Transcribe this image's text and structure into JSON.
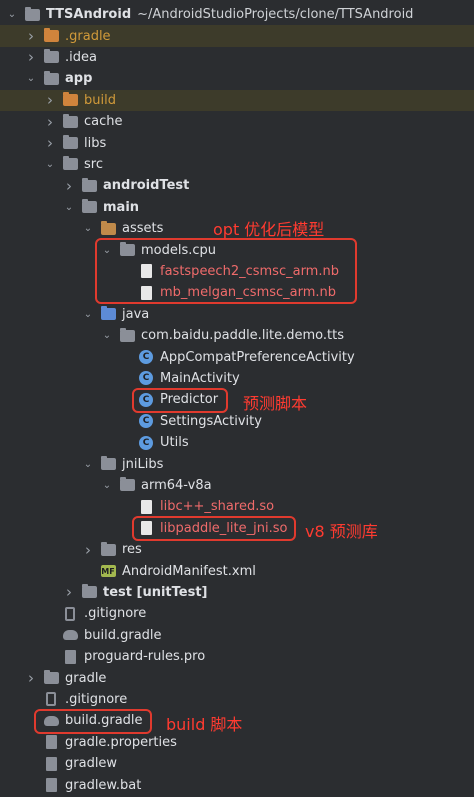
{
  "project": {
    "name": "TTSAndroid",
    "path": "~/AndroidStudioProjects/clone/TTSAndroid"
  },
  "tree": [
    {
      "label": "TTSAndroid",
      "hint": "~/AndroidStudioProjects/clone/TTSAndroid",
      "bold": true,
      "icon": "folder",
      "chev": "down",
      "depth": 0
    },
    {
      "label": ".gradle",
      "icon": "folder-orange",
      "chev": "right",
      "depth": 1,
      "style": "orange",
      "row": "hl-yellow"
    },
    {
      "label": ".idea",
      "icon": "folder",
      "chev": "right",
      "depth": 1
    },
    {
      "label": "app",
      "icon": "folder",
      "chev": "down",
      "depth": 1,
      "bold": true
    },
    {
      "label": "build",
      "icon": "folder-orange",
      "chev": "right",
      "depth": 2,
      "style": "orange",
      "row": "hl-yellow"
    },
    {
      "label": "cache",
      "icon": "folder",
      "chev": "right",
      "depth": 2
    },
    {
      "label": "libs",
      "icon": "folder",
      "chev": "right",
      "depth": 2
    },
    {
      "label": "src",
      "icon": "folder",
      "chev": "down",
      "depth": 2
    },
    {
      "label": "androidTest",
      "icon": "folder",
      "chev": "right",
      "depth": 3,
      "bold": true
    },
    {
      "label": "main",
      "icon": "folder",
      "chev": "down",
      "depth": 3,
      "bold": true
    },
    {
      "label": "assets",
      "icon": "folder-brown",
      "chev": "down",
      "depth": 4
    },
    {
      "label": "models.cpu",
      "icon": "folder",
      "chev": "down",
      "depth": 5
    },
    {
      "label": "fastspeech2_csmsc_arm.nb",
      "icon": "file",
      "chev": "none",
      "depth": 6,
      "style": "red"
    },
    {
      "label": "mb_melgan_csmsc_arm.nb",
      "icon": "file",
      "chev": "none",
      "depth": 6,
      "style": "red"
    },
    {
      "label": "java",
      "icon": "folder-blue",
      "chev": "down",
      "depth": 4
    },
    {
      "label": "com.baidu.paddle.lite.demo.tts",
      "icon": "folder",
      "chev": "down",
      "depth": 5
    },
    {
      "label": "AppCompatPreferenceActivity",
      "icon": "class",
      "chev": "none",
      "depth": 6
    },
    {
      "label": "MainActivity",
      "icon": "class",
      "chev": "none",
      "depth": 6
    },
    {
      "label": "Predictor",
      "icon": "class",
      "chev": "none",
      "depth": 6
    },
    {
      "label": "SettingsActivity",
      "icon": "class",
      "chev": "none",
      "depth": 6
    },
    {
      "label": "Utils",
      "icon": "class",
      "chev": "none",
      "depth": 6
    },
    {
      "label": "jniLibs",
      "icon": "folder",
      "chev": "down",
      "depth": 4
    },
    {
      "label": "arm64-v8a",
      "icon": "folder",
      "chev": "down",
      "depth": 5
    },
    {
      "label": "libc++_shared.so",
      "icon": "file",
      "chev": "none",
      "depth": 6,
      "style": "red"
    },
    {
      "label": "libpaddle_lite_jni.so",
      "icon": "file",
      "chev": "none",
      "depth": 6,
      "style": "red"
    },
    {
      "label": "res",
      "icon": "folder",
      "chev": "right",
      "depth": 4
    },
    {
      "label": "AndroidManifest.xml",
      "icon": "manifest",
      "chev": "none",
      "depth": 4
    },
    {
      "label": "test [unitTest]",
      "icon": "folder",
      "chev": "right",
      "depth": 3,
      "bold": true
    },
    {
      "label": ".gitignore",
      "icon": "git",
      "chev": "none",
      "depth": 2
    },
    {
      "label": "build.gradle",
      "icon": "gradle",
      "chev": "none",
      "depth": 2
    },
    {
      "label": "proguard-rules.pro",
      "icon": "file-gray",
      "chev": "none",
      "depth": 2
    },
    {
      "label": "gradle",
      "icon": "folder",
      "chev": "right",
      "depth": 1
    },
    {
      "label": ".gitignore",
      "icon": "git",
      "chev": "none",
      "depth": 1
    },
    {
      "label": "build.gradle",
      "icon": "gradle",
      "chev": "none",
      "depth": 1
    },
    {
      "label": "gradle.properties",
      "icon": "file-gray",
      "chev": "none",
      "depth": 1
    },
    {
      "label": "gradlew",
      "icon": "file-gray",
      "chev": "none",
      "depth": 1
    },
    {
      "label": "gradlew.bat",
      "icon": "file-gray",
      "chev": "none",
      "depth": 1
    }
  ],
  "annotations": {
    "opt": "opt 优化后模型",
    "predictor": "预测脚本",
    "v8": "v8 预测库",
    "build": "build 脚本"
  },
  "colors": {
    "background": "#2b2d30",
    "annotation": "#ff3b30",
    "selection": "#2e436e"
  }
}
